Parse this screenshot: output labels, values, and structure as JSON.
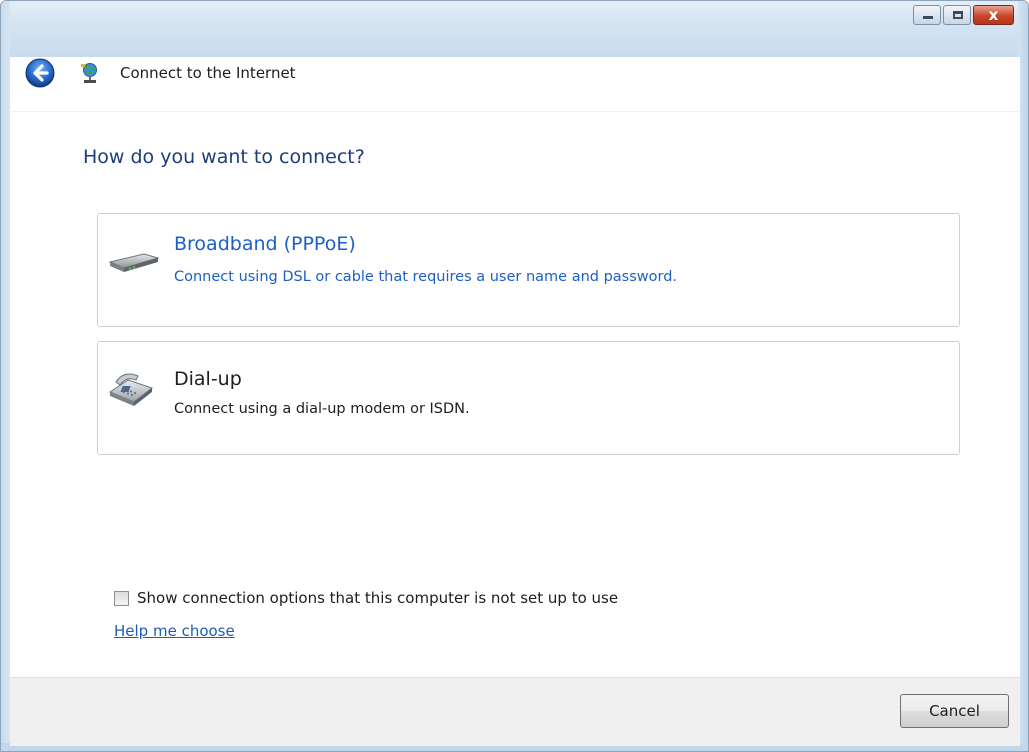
{
  "window": {
    "title": "Connect to the Internet",
    "caption_buttons": [
      "minimize",
      "maximize",
      "close"
    ],
    "close_glyph": "x"
  },
  "heading": "How do you want to connect?",
  "options": [
    {
      "title": "Broadband (PPPoE)",
      "description": "Connect using DSL or cable that requires a user name and password.",
      "icon": "broadband-modem-icon"
    },
    {
      "title": "Dial-up",
      "description": "Connect using a dial-up modem or ISDN.",
      "icon": "dialup-phone-icon"
    }
  ],
  "show_options_checkbox": {
    "label": "Show connection options that this computer is not set up to use",
    "checked": false
  },
  "help_link": "Help me choose",
  "footer": {
    "cancel_label": "Cancel"
  },
  "colors": {
    "heading": "#1e3c7c",
    "link": "#1d5fc6",
    "footer_bg": "#f0f0f0"
  }
}
